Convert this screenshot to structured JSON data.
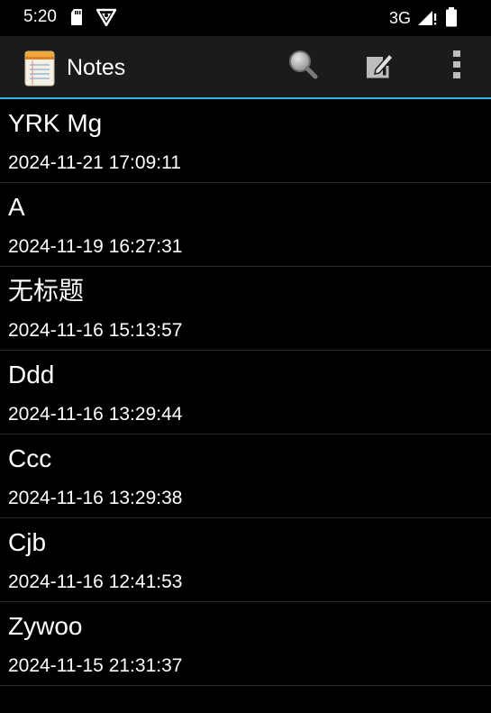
{
  "status_bar": {
    "time": "5:20",
    "network_type": "3G",
    "icons": [
      "sd-card-icon",
      "vpn-shield-icon",
      "signal-icon",
      "battery-icon"
    ]
  },
  "action_bar": {
    "title": "Notes",
    "app_icon": "notepad-icon",
    "actions": [
      "search-icon",
      "new-note-icon",
      "overflow-menu-icon"
    ],
    "accent_color": "#33b5e5"
  },
  "notes": [
    {
      "title": "YRK Mg",
      "date": "2024-11-21 17:09:11"
    },
    {
      "title": "A",
      "date": "2024-11-19 16:27:31"
    },
    {
      "title": "无标题",
      "date": "2024-11-16 15:13:57"
    },
    {
      "title": "Ddd",
      "date": "2024-11-16 13:29:44"
    },
    {
      "title": "Ccc",
      "date": "2024-11-16 13:29:38"
    },
    {
      "title": "Cjb",
      "date": "2024-11-16 12:41:53"
    },
    {
      "title": "Zywoo",
      "date": "2024-11-15 21:31:37"
    }
  ]
}
